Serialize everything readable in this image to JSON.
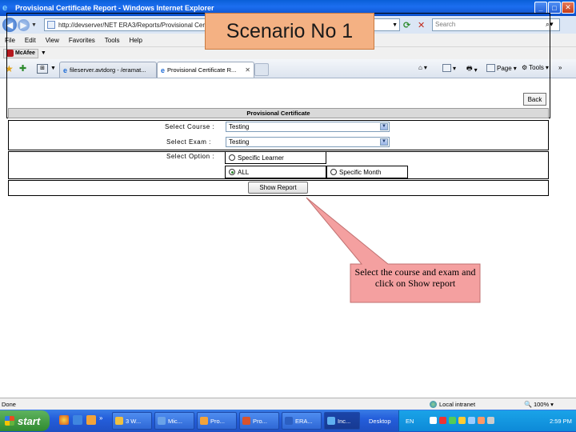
{
  "window": {
    "title": "Provisional Certificate Report - Windows Internet Explorer",
    "controls": [
      "_",
      "□",
      "✕"
    ]
  },
  "address_bar": {
    "url": "http://devserver/NET ERA3/Reports/Provisional Certi.aspx",
    "search_placeholder": "Search"
  },
  "menu": {
    "items": [
      "File",
      "Edit",
      "View",
      "Favorites",
      "Tools",
      "Help"
    ]
  },
  "mcafee": {
    "label": "McAfee"
  },
  "tabs": [
    {
      "label": "fileserver.avtdorg - /eramat...",
      "active": false
    },
    {
      "label": "Provisional Certificate R...",
      "active": true
    }
  ],
  "command_bar": {
    "page_label": "Page",
    "tools_label": "Tools",
    "more": "»"
  },
  "scenario": {
    "label": "Scenario No 1"
  },
  "form": {
    "back_label": "Back",
    "header": "Provisional Certificate",
    "course_label": "Select Course :",
    "course_value": "Testing",
    "exam_label": "Select Exam :",
    "exam_value": "Testing",
    "option_label": "Select Option :",
    "options": [
      {
        "label": "Specific Learner",
        "checked": false
      },
      {
        "label": "ALL",
        "checked": true
      },
      {
        "label": "Specific Month",
        "checked": false
      }
    ],
    "show_report_label": "Show Report"
  },
  "callout": {
    "text": "Select the course and exam and click on Show report"
  },
  "status": {
    "left": "Done",
    "zone": "Local intranet",
    "zoom": "100%"
  },
  "taskbar": {
    "start_label": "start",
    "tasks": [
      "3 W...",
      "Mic...",
      "Pro...",
      "Pro...",
      "ERA...",
      "Inc..."
    ],
    "desktop_label": "Desktop",
    "lang": "EN",
    "clock": "2:59 PM"
  },
  "colors": {
    "scenario_fill": "#f4b183",
    "callout_fill": "#f4a0a0",
    "titlebar": "#0a5fd8",
    "taskbar": "#245edb"
  }
}
